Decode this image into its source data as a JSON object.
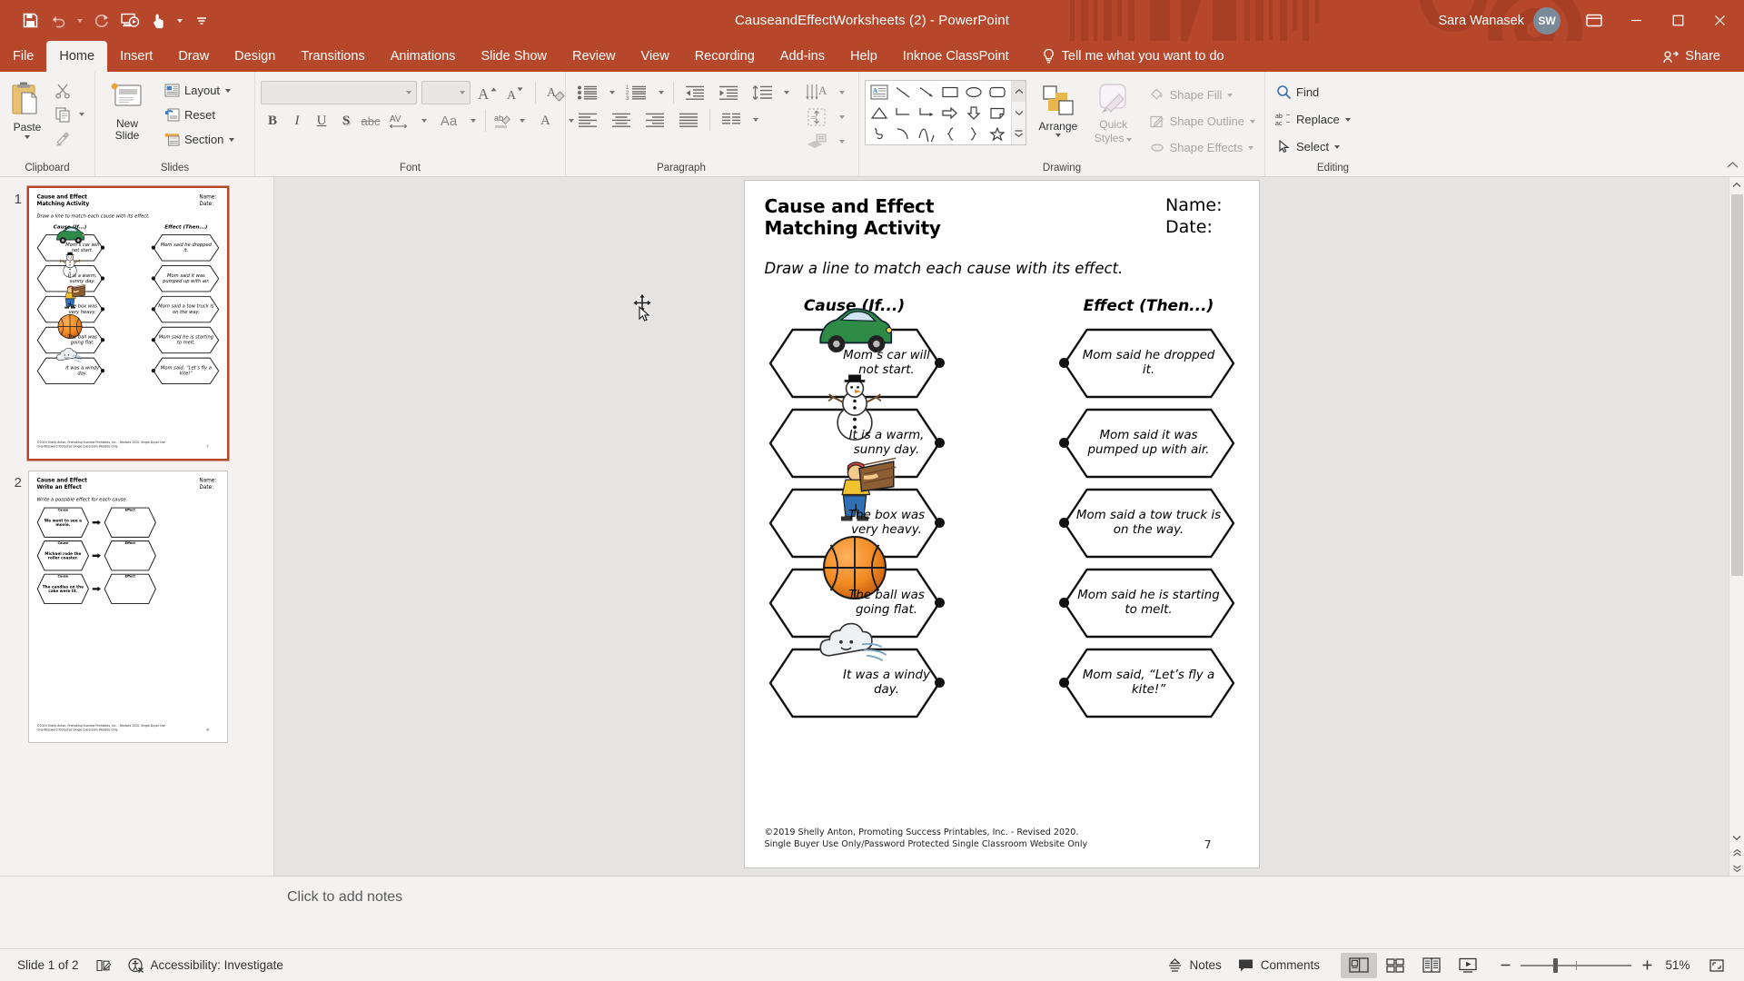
{
  "app": {
    "title": "CauseandEffectWorksheets (2)  -  PowerPoint",
    "user_name": "Sara Wanasek",
    "avatar_initials": "SW",
    "accent_color": "#b7472a"
  },
  "quick_access": {
    "items": [
      {
        "name": "save-button",
        "icon": "save-icon",
        "label": "Save"
      },
      {
        "name": "undo-button",
        "icon": "undo-icon",
        "label": "Undo"
      },
      {
        "name": "redo-button",
        "icon": "redo-icon",
        "label": "Redo"
      },
      {
        "name": "start-presentation-button",
        "icon": "present-icon",
        "label": "Start From Beginning"
      },
      {
        "name": "touch-mode-button",
        "icon": "touch-pointer-icon",
        "label": "Touch/Mouse Mode"
      },
      {
        "name": "customize-qat-button",
        "icon": "more-icon",
        "label": "Customize Quick Access Toolbar"
      }
    ]
  },
  "window_controls": {
    "ribbon_display": "Ribbon Display Options",
    "minimize": "Minimize",
    "restore": "Restore Down",
    "close": "Close"
  },
  "tabs": [
    {
      "label": "File",
      "active": false
    },
    {
      "label": "Home",
      "active": true
    },
    {
      "label": "Insert",
      "active": false
    },
    {
      "label": "Draw",
      "active": false
    },
    {
      "label": "Design",
      "active": false
    },
    {
      "label": "Transitions",
      "active": false
    },
    {
      "label": "Animations",
      "active": false
    },
    {
      "label": "Slide Show",
      "active": false
    },
    {
      "label": "Review",
      "active": false
    },
    {
      "label": "View",
      "active": false
    },
    {
      "label": "Recording",
      "active": false
    },
    {
      "label": "Add-ins",
      "active": false
    },
    {
      "label": "Help",
      "active": false
    },
    {
      "label": "Inknoe ClassPoint",
      "active": false
    }
  ],
  "tell_me": {
    "label": "Tell me what you want to do"
  },
  "share": {
    "label": "Share"
  },
  "ribbon": {
    "clipboard": {
      "label": "Clipboard",
      "paste": "Paste",
      "cut": "Cut",
      "copy": "Copy",
      "format_painter": "Format Painter"
    },
    "slides": {
      "label": "Slides",
      "new_slide": "New\nSlide",
      "new_slide_line1": "New",
      "new_slide_line2": "Slide",
      "layout": "Layout",
      "reset": "Reset",
      "section": "Section"
    },
    "font": {
      "label": "Font",
      "font_name": "",
      "font_size": "",
      "bold": "B",
      "italic": "I",
      "underline": "U",
      "shadow": "S",
      "strikethrough": "abc",
      "character_spacing": "AV",
      "change_case": "Aa",
      "increase_font": "A",
      "decrease_font": "A",
      "clear_formatting": "Clear All Formatting",
      "text_highlight": "ab",
      "font_color": "A"
    },
    "paragraph": {
      "label": "Paragraph",
      "bullets": "Bullets",
      "numbering": "Numbering",
      "decrease_indent": "Decrease List Level",
      "increase_indent": "Increase List Level",
      "line_spacing": "Line Spacing",
      "text_direction": "Text Direction",
      "align_text": "Align Text",
      "convert_smartart": "Convert to SmartArt",
      "align_left": "Align Left",
      "align_center": "Center",
      "align_right": "Align Right",
      "justify": "Justify",
      "columns": "Columns"
    },
    "drawing": {
      "label": "Drawing",
      "arrange": "Arrange",
      "quick_styles_line1": "Quick",
      "quick_styles_line2": "Styles",
      "shape_fill": "Shape Fill",
      "shape_outline": "Shape Outline",
      "shape_effects": "Shape Effects",
      "shapes": [
        "text-box",
        "line",
        "line-arrow",
        "rectangle",
        "oval",
        "rounded-rectangle",
        "triangle",
        "elbow-connector",
        "elbow-arrow-connector",
        "right-arrow",
        "down-arrow",
        "folded-corner",
        "scribble",
        "arc",
        "curve",
        "left-brace",
        "right-brace",
        "star"
      ]
    },
    "editing": {
      "label": "Editing",
      "find": "Find",
      "replace": "Replace",
      "select": "Select"
    }
  },
  "thumbnails": [
    {
      "number": "1",
      "selected": true
    },
    {
      "number": "2",
      "selected": false
    }
  ],
  "slide": {
    "title_line1": "Cause and Effect",
    "title_line2": "Matching Activity",
    "name_label": "Name:",
    "date_label": "Date:",
    "instruction": "Draw a line to match each cause with its effect.",
    "cause_header": "Cause (If...)",
    "effect_header": "Effect (Then...)",
    "causes": [
      {
        "text": "Mom’s car will not start.",
        "art": "green-car"
      },
      {
        "text": "It is a warm, sunny day.",
        "art": "snowman"
      },
      {
        "text": "The  box was very heavy.",
        "art": "person-carrying-box"
      },
      {
        "text": "The ball was going flat.",
        "art": "basketball"
      },
      {
        "text": "It was a windy day.",
        "art": "wind-cloud"
      }
    ],
    "effects": [
      {
        "text": "Mom said he dropped it."
      },
      {
        "text": "Mom said  it was pumped up with air."
      },
      {
        "text": "Mom said a tow truck is on the way."
      },
      {
        "text": "Mom said he is starting to melt."
      },
      {
        "text": "Mom said, “Let’s fly a kite!”"
      }
    ],
    "copyright": "©2019 Shelly Anton, Promoting Success Printables, Inc. - Revised 2020. Single Buyer Use Only/Password Protected Single Classroom Website Only",
    "page_number": "7"
  },
  "slide2": {
    "title_line1": "Cause and Effect",
    "title_line2": "Write an Effect",
    "name_label": "Name:",
    "date_label": "Date:",
    "instruction": "Write a possible effect for each cause.",
    "cause_label": "Cause",
    "effect_label": "Effect",
    "causes": [
      "We went to see a movie.",
      "Michael rode the roller coaster.",
      "The candles on the cake were lit."
    ],
    "copyright": "©2019 Shelly Anton, Promoting Success Printables, Inc. - Revised 2020. Single Buyer Use Only/Password Protected Single Classroom Website Only",
    "page_number": "8"
  },
  "notes": {
    "placeholder": "Click to add notes"
  },
  "status": {
    "slide_indicator": "Slide 1 of 2",
    "accessibility": "Accessibility: Investigate",
    "notes_button": "Notes",
    "comments_button": "Comments",
    "zoom_level": "51%",
    "views": [
      {
        "name": "normal-view",
        "active": true
      },
      {
        "name": "slide-sorter-view",
        "active": false
      },
      {
        "name": "reading-view",
        "active": false
      },
      {
        "name": "slide-show-view",
        "active": false
      }
    ],
    "fit_to_window": "Fit slide to current window"
  }
}
